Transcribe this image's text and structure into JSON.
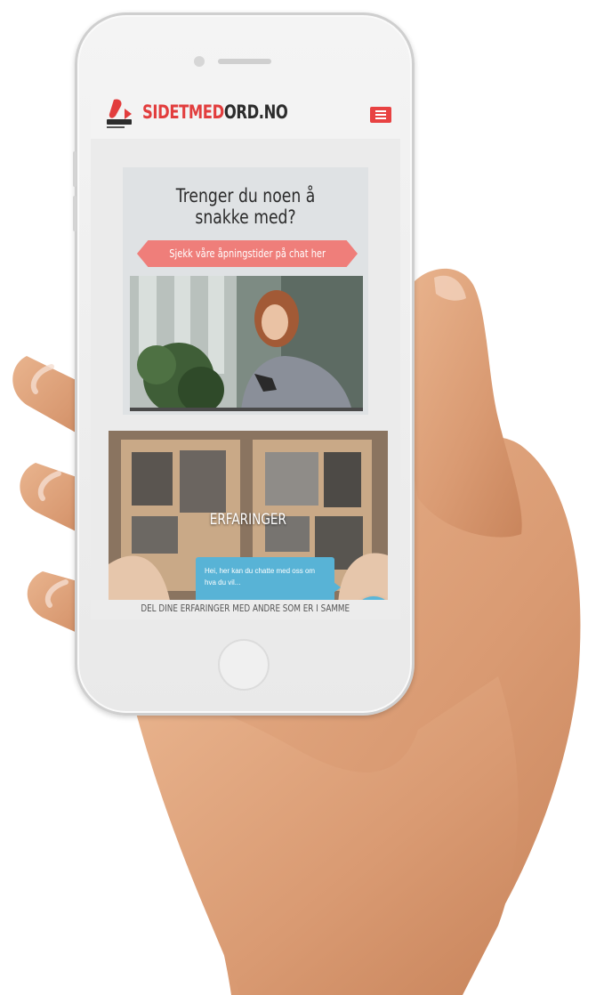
{
  "header": {
    "logo_text_red": "SIDETMED",
    "logo_text_dark": "ORD.NO",
    "menu_icon": "hamburger-icon",
    "brand_color": "#e23d3d"
  },
  "hero": {
    "title_line1": "Trenger du noen å",
    "title_line2": "snakke med?",
    "cta_label": "Sjekk våre åpningstider på chat her",
    "cta_color": "#ef7e7a"
  },
  "experiences": {
    "title": "ERFARINGER",
    "subtitle": "DEL DINE ERFARINGER MED ANDRE SOM ER I SAMME"
  },
  "chat": {
    "bubble_text": "Hei, her kan du chatte med oss om hva du vil...",
    "fab_icon": "chat-icon",
    "accent_color": "#58b3d6"
  }
}
